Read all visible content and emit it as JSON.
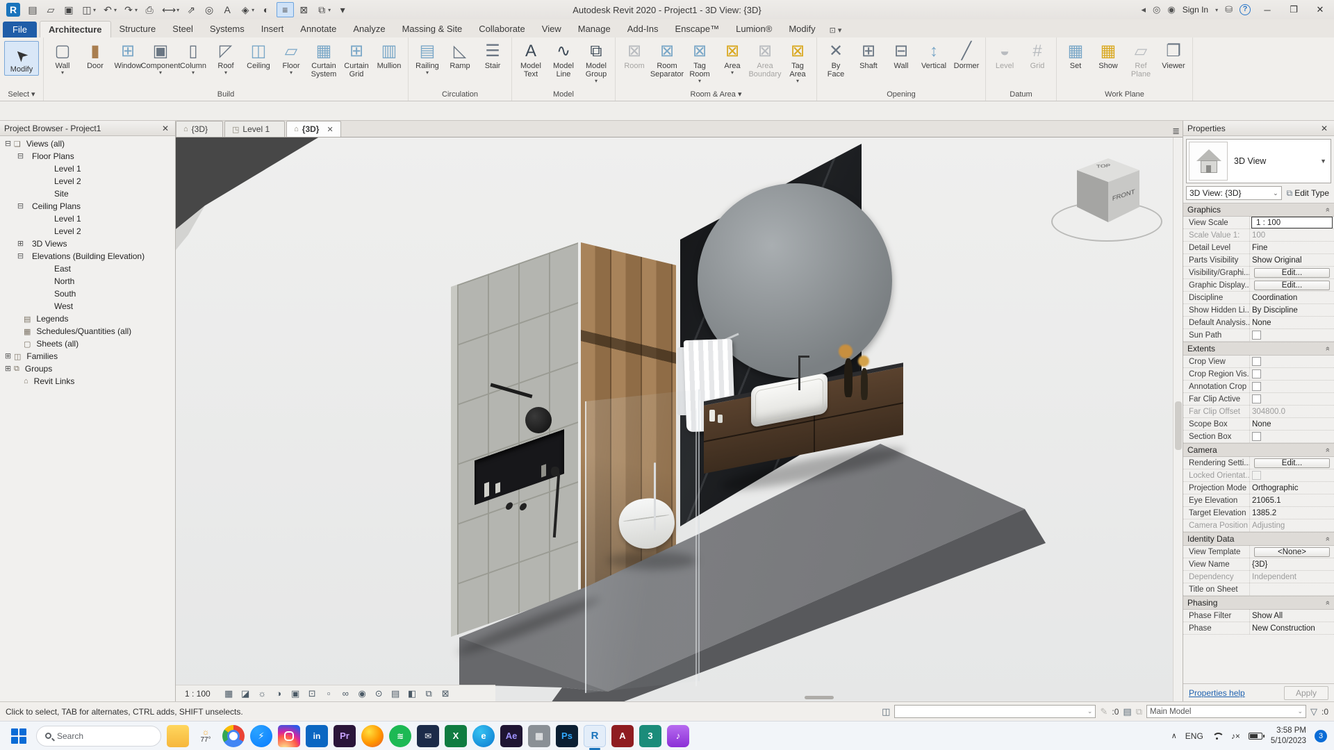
{
  "window": {
    "title": "Autodesk Revit 2020 - Project1 - 3D View: {3D}",
    "sign_in": "Sign In",
    "minimize": "─",
    "restore": "❐",
    "close": "✕"
  },
  "qat": [
    {
      "n": "revit-logo",
      "g": "R",
      "cls": "logo",
      "arrow": ""
    },
    {
      "n": "project-properties-icon",
      "g": "▤",
      "arrow": ""
    },
    {
      "n": "open-icon",
      "g": "▱",
      "arrow": ""
    },
    {
      "n": "save-icon",
      "g": "▣",
      "arrow": ""
    },
    {
      "n": "sync-with-central-icon",
      "g": "◫",
      "arrow": "▾"
    },
    {
      "n": "undo-icon",
      "g": "↶",
      "arrow": "▾"
    },
    {
      "n": "redo-icon",
      "g": "↷",
      "arrow": "▾"
    },
    {
      "n": "print-icon",
      "g": "⎙",
      "arrow": ""
    },
    {
      "n": "measure-icon",
      "g": "⟷",
      "arrow": "▾"
    },
    {
      "n": "aligned-dimension-icon",
      "g": "⇗",
      "arrow": ""
    },
    {
      "n": "tag-by-category-icon",
      "g": "◎",
      "arrow": ""
    },
    {
      "n": "text-icon",
      "g": "A",
      "arrow": ""
    },
    {
      "n": "default-3d-view-icon",
      "g": "◈",
      "arrow": "▾"
    },
    {
      "n": "section-icon",
      "g": "◐",
      "arrow": ""
    },
    {
      "n": "thin-lines-icon",
      "g": "≡",
      "cls": "active",
      "arrow": ""
    },
    {
      "n": "close-inactive-windows-icon",
      "g": "⊠",
      "arrow": ""
    },
    {
      "n": "switch-windows-icon",
      "g": "⧉",
      "arrow": "▾"
    },
    {
      "n": "customize-qat-icon",
      "g": "▾",
      "arrow": ""
    }
  ],
  "ribbon": {
    "file_tab": "File",
    "tabs": [
      {
        "label": "Architecture",
        "cls": "active"
      },
      {
        "label": "Structure"
      },
      {
        "label": "Steel"
      },
      {
        "label": "Systems"
      },
      {
        "label": "Insert"
      },
      {
        "label": "Annotate"
      },
      {
        "label": "Analyze"
      },
      {
        "label": "Massing & Site"
      },
      {
        "label": "Collaborate"
      },
      {
        "label": "View"
      },
      {
        "label": "Manage"
      },
      {
        "label": "Add-Ins"
      },
      {
        "label": "Enscape™"
      },
      {
        "label": "Lumion®"
      },
      {
        "label": "Modify"
      }
    ],
    "tab_extra": "⊡ ▾",
    "modify_label": "Modify",
    "select_label": "Select ▾",
    "panels": [
      {
        "label": "Build",
        "buttons": [
          {
            "label": "Wall",
            "glyph": "▢",
            "icls": "",
            "arrow": "▾",
            "cls": ""
          },
          {
            "label": "Door",
            "glyph": "▮",
            "icls": "i-wood",
            "arrow": "",
            "cls": ""
          },
          {
            "label": "Window",
            "glyph": "⊞",
            "icls": "i-blue",
            "arrow": "",
            "cls": ""
          },
          {
            "label": "Component",
            "glyph": "▣",
            "icls": "",
            "arrow": "▾",
            "cls": ""
          },
          {
            "label": "Column",
            "glyph": "▯",
            "icls": "",
            "arrow": "▾",
            "cls": ""
          },
          {
            "label": "Roof",
            "glyph": "◸",
            "icls": "",
            "arrow": "▾",
            "cls": ""
          },
          {
            "label": "Ceiling",
            "glyph": "◫",
            "icls": "i-blue",
            "arrow": "",
            "cls": ""
          },
          {
            "label": "Floor",
            "glyph": "▱",
            "icls": "i-blue",
            "arrow": "▾",
            "cls": ""
          },
          {
            "label": "Curtain\nSystem",
            "glyph": "▦",
            "icls": "i-blue",
            "arrow": "",
            "cls": ""
          },
          {
            "label": "Curtain\nGrid",
            "glyph": "⊞",
            "icls": "i-blue",
            "arrow": "",
            "cls": ""
          },
          {
            "label": "Mullion",
            "glyph": "▥",
            "icls": "i-blue",
            "arrow": "",
            "cls": ""
          }
        ]
      },
      {
        "label": "Circulation",
        "buttons": [
          {
            "label": "Railing",
            "glyph": "▤",
            "icls": "i-blue",
            "arrow": "▾",
            "cls": ""
          },
          {
            "label": "Ramp",
            "glyph": "◺",
            "icls": "",
            "arrow": "",
            "cls": ""
          },
          {
            "label": "Stair",
            "glyph": "☰",
            "icls": "",
            "arrow": "",
            "cls": ""
          }
        ]
      },
      {
        "label": "Model",
        "buttons": [
          {
            "label": "Model\nText",
            "glyph": "A",
            "icls": "i-dark",
            "arrow": "",
            "cls": ""
          },
          {
            "label": "Model\nLine",
            "glyph": "∿",
            "icls": "i-dark",
            "arrow": "",
            "cls": ""
          },
          {
            "label": "Model\nGroup",
            "glyph": "⧉",
            "icls": "i-dark",
            "arrow": "▾",
            "cls": ""
          }
        ]
      },
      {
        "label": "Room & Area ▾",
        "buttons": [
          {
            "label": "Room",
            "glyph": "⊠",
            "icls": "",
            "arrow": "",
            "cls": "dis"
          },
          {
            "label": "Room\nSeparator",
            "glyph": "⊠",
            "icls": "i-blue",
            "arrow": "",
            "cls": ""
          },
          {
            "label": "Tag\nRoom",
            "glyph": "⊠",
            "icls": "i-blue",
            "arrow": "▾",
            "cls": ""
          },
          {
            "label": "Area",
            "glyph": "⊠",
            "icls": "i-yellow",
            "arrow": "▾",
            "cls": ""
          },
          {
            "label": "Area\nBoundary",
            "glyph": "⊠",
            "icls": "",
            "arrow": "",
            "cls": "dis"
          },
          {
            "label": "Tag\nArea",
            "glyph": "⊠",
            "icls": "i-yellow",
            "arrow": "▾",
            "cls": ""
          }
        ]
      },
      {
        "label": "Opening",
        "buttons": [
          {
            "label": "By\nFace",
            "glyph": "✕",
            "icls": "",
            "arrow": "",
            "cls": ""
          },
          {
            "label": "Shaft",
            "glyph": "⊞",
            "icls": "",
            "arrow": "",
            "cls": ""
          },
          {
            "label": "Wall",
            "glyph": "⊟",
            "icls": "",
            "arrow": "",
            "cls": ""
          },
          {
            "label": "Vertical",
            "glyph": "↕",
            "icls": "i-blue",
            "arrow": "",
            "cls": ""
          },
          {
            "label": "Dormer",
            "glyph": "╱",
            "icls": "",
            "arrow": "",
            "cls": ""
          }
        ]
      },
      {
        "label": "Datum",
        "buttons": [
          {
            "label": "Level",
            "glyph": "◒",
            "icls": "",
            "arrow": "",
            "cls": "dis"
          },
          {
            "label": "Grid",
            "glyph": "#",
            "icls": "",
            "arrow": "",
            "cls": "dis"
          }
        ]
      },
      {
        "label": "Work Plane",
        "buttons": [
          {
            "label": "Set",
            "glyph": "▦",
            "icls": "i-blue",
            "arrow": "",
            "cls": ""
          },
          {
            "label": "Show",
            "glyph": "▦",
            "icls": "i-yellow",
            "arrow": "",
            "cls": ""
          },
          {
            "label": "Ref\nPlane",
            "glyph": "▱",
            "icls": "",
            "arrow": "",
            "cls": "dis"
          },
          {
            "label": "Viewer",
            "glyph": "❐",
            "icls": "",
            "arrow": "",
            "cls": ""
          }
        ]
      }
    ]
  },
  "browser": {
    "title": "Project Browser - Project1",
    "close": "✕",
    "tree": [
      {
        "g": "⊟",
        "ig": "❏",
        "label": "Views (all)",
        "d": "t0",
        "cls": "sel"
      },
      {
        "g": "⊟",
        "ig": "",
        "label": "Floor Plans",
        "d": "t1",
        "cls": ""
      },
      {
        "g": "",
        "ig": "",
        "label": "Level 1",
        "d": "t2",
        "cls": ""
      },
      {
        "g": "",
        "ig": "",
        "label": "Level 2",
        "d": "t2",
        "cls": ""
      },
      {
        "g": "",
        "ig": "",
        "label": "Site",
        "d": "t2",
        "cls": ""
      },
      {
        "g": "⊟",
        "ig": "",
        "label": "Ceiling Plans",
        "d": "t1",
        "cls": ""
      },
      {
        "g": "",
        "ig": "",
        "label": "Level 1",
        "d": "t2",
        "cls": ""
      },
      {
        "g": "",
        "ig": "",
        "label": "Level 2",
        "d": "t2",
        "cls": ""
      },
      {
        "g": "⊞",
        "ig": "",
        "label": "3D Views",
        "d": "t1",
        "cls": ""
      },
      {
        "g": "⊟",
        "ig": "",
        "label": "Elevations (Building Elevation)",
        "d": "t1",
        "cls": ""
      },
      {
        "g": "",
        "ig": "",
        "label": "East",
        "d": "t2",
        "cls": ""
      },
      {
        "g": "",
        "ig": "",
        "label": "North",
        "d": "t2",
        "cls": ""
      },
      {
        "g": "",
        "ig": "",
        "label": "South",
        "d": "t2",
        "cls": ""
      },
      {
        "g": "",
        "ig": "",
        "label": "West",
        "d": "t2",
        "cls": ""
      },
      {
        "g": "",
        "ig": "▤",
        "label": "Legends",
        "d": "t0b",
        "cls": ""
      },
      {
        "g": "",
        "ig": "▦",
        "label": "Schedules/Quantities (all)",
        "d": "t0b",
        "cls": ""
      },
      {
        "g": "",
        "ig": "▢",
        "label": "Sheets (all)",
        "d": "t0b",
        "cls": ""
      },
      {
        "g": "⊞",
        "ig": "◫",
        "label": "Families",
        "d": "t0",
        "cls": ""
      },
      {
        "g": "⊞",
        "ig": "⧉",
        "label": "Groups",
        "d": "t0",
        "cls": ""
      },
      {
        "g": "",
        "ig": "⌂",
        "label": "Revit Links",
        "d": "t0b",
        "cls": ""
      }
    ]
  },
  "view_tabs": {
    "tabs": [
      {
        "icon": "⌂",
        "label": "{3D}",
        "close": "",
        "cls": ""
      },
      {
        "icon": "◳",
        "label": "Level 1",
        "close": "",
        "cls": ""
      },
      {
        "icon": "⌂",
        "label": "{3D}",
        "close": "✕",
        "cls": "active"
      }
    ],
    "list_icon": "≣"
  },
  "viewcube": {
    "top": "TOP",
    "front": "FRONT"
  },
  "vcb": {
    "scale": "1 : 100",
    "icons": [
      {
        "n": "detail-level-icon",
        "g": "▦"
      },
      {
        "n": "visual-style-icon",
        "g": "◪"
      },
      {
        "n": "sun-path-icon",
        "g": "☼"
      },
      {
        "n": "shadows-icon",
        "g": "◑"
      },
      {
        "n": "show-rendering-dialog-icon",
        "g": "▣"
      },
      {
        "n": "crop-view-icon",
        "g": "⊡"
      },
      {
        "n": "show-crop-region-icon",
        "g": "▫"
      },
      {
        "n": "temporary-hide-isolate-icon",
        "g": "∞"
      },
      {
        "n": "reveal-hidden-elements-icon",
        "g": "◉"
      },
      {
        "n": "temporary-view-properties-icon",
        "g": "⊙"
      },
      {
        "n": "show-analytical-model-icon",
        "g": "▤"
      },
      {
        "n": "highlight-displacement-sets-icon",
        "g": "◧"
      },
      {
        "n": "reveal-constraints-icon",
        "g": "⧉"
      },
      {
        "n": "lock-3d-view-icon",
        "g": "⊠"
      }
    ]
  },
  "properties": {
    "title": "Properties",
    "close": "✕",
    "type_name": "3D View",
    "view_combo": "3D View: {3D}",
    "edit_type": "Edit Type",
    "sections": [
      {
        "title": "Graphics",
        "rows": [
          {
            "label": "View Scale",
            "value": "1 : 100",
            "vcls": "field",
            "lcls": ""
          },
          {
            "label": "Scale Value    1:",
            "value": "100",
            "vcls": "dis",
            "lcls": "dis"
          },
          {
            "label": "Detail Level",
            "value": "Fine",
            "vcls": "",
            "lcls": ""
          },
          {
            "label": "Parts Visibility",
            "value": "Show Original",
            "vcls": "",
            "lcls": ""
          },
          {
            "label": "Visibility/Graphi...",
            "value": "Edit...",
            "vcls": "btn",
            "lcls": ""
          },
          {
            "label": "Graphic Display...",
            "value": "Edit...",
            "vcls": "btn",
            "lcls": ""
          },
          {
            "label": "Discipline",
            "value": "Coordination",
            "vcls": "",
            "lcls": ""
          },
          {
            "label": "Show Hidden Li...",
            "value": "By Discipline",
            "vcls": "",
            "lcls": ""
          },
          {
            "label": "Default Analysis...",
            "value": "None",
            "vcls": "",
            "lcls": ""
          },
          {
            "label": "Sun Path",
            "value": "",
            "vcls": "check",
            "lcls": ""
          }
        ]
      },
      {
        "title": "Extents",
        "rows": [
          {
            "label": "Crop View",
            "value": "",
            "vcls": "check",
            "lcls": ""
          },
          {
            "label": "Crop Region Vis...",
            "value": "",
            "vcls": "check",
            "lcls": ""
          },
          {
            "label": "Annotation Crop",
            "value": "",
            "vcls": "check",
            "lcls": ""
          },
          {
            "label": "Far Clip Active",
            "value": "",
            "vcls": "check",
            "lcls": ""
          },
          {
            "label": "Far Clip Offset",
            "value": "304800.0",
            "vcls": "dis",
            "lcls": "dis"
          },
          {
            "label": "Scope Box",
            "value": "None",
            "vcls": "",
            "lcls": ""
          },
          {
            "label": "Section Box",
            "value": "",
            "vcls": "check",
            "lcls": ""
          }
        ]
      },
      {
        "title": "Camera",
        "rows": [
          {
            "label": "Rendering Setti...",
            "value": "Edit...",
            "vcls": "btn",
            "lcls": ""
          },
          {
            "label": "Locked Orientat...",
            "value": "",
            "vcls": "check dis",
            "lcls": "dis"
          },
          {
            "label": "Projection Mode",
            "value": "Orthographic",
            "vcls": "",
            "lcls": ""
          },
          {
            "label": "Eye Elevation",
            "value": "21065.1",
            "vcls": "",
            "lcls": ""
          },
          {
            "label": "Target Elevation",
            "value": "1385.2",
            "vcls": "",
            "lcls": ""
          },
          {
            "label": "Camera Position",
            "value": "Adjusting",
            "vcls": "dis",
            "lcls": "dis"
          }
        ]
      },
      {
        "title": "Identity Data",
        "rows": [
          {
            "label": "View Template",
            "value": "<None>",
            "vcls": "btn",
            "lcls": ""
          },
          {
            "label": "View Name",
            "value": "{3D}",
            "vcls": "",
            "lcls": ""
          },
          {
            "label": "Dependency",
            "value": "Independent",
            "vcls": "dis",
            "lcls": "dis"
          },
          {
            "label": "Title on Sheet",
            "value": "",
            "vcls": "",
            "lcls": ""
          }
        ]
      },
      {
        "title": "Phasing",
        "rows": [
          {
            "label": "Phase Filter",
            "value": "Show All",
            "vcls": "",
            "lcls": ""
          },
          {
            "label": "Phase",
            "value": "New Construction",
            "vcls": "",
            "lcls": ""
          }
        ]
      }
    ],
    "help": "Properties help",
    "apply": "Apply"
  },
  "status_bar": {
    "hint": "Click to select, TAB for alternates, CTRL adds, SHIFT unselects.",
    "workset_value": "",
    "editable_count": ":0",
    "main_model": "Main Model",
    "filter_count": ":0"
  },
  "taskbar": {
    "search_placeholder": "Search",
    "icons": [
      {
        "n": "file-explorer-icon",
        "cls": "tb-folder",
        "g": "",
        "label": ""
      },
      {
        "n": "weather-icon",
        "cls": "tb-weather",
        "g": "☼",
        "label": "77°"
      },
      {
        "n": "chrome-icon",
        "cls": "tb-chrome",
        "g": "",
        "label": ""
      },
      {
        "n": "messenger-icon",
        "cls": "tb-msg",
        "g": "⚡",
        "label": ""
      },
      {
        "n": "instagram-icon",
        "cls": "tb-insta",
        "g": "",
        "label": ""
      },
      {
        "n": "linkedin-icon",
        "cls": "tb-li",
        "g": "in",
        "label": ""
      },
      {
        "n": "premiere-icon",
        "cls": "tb-pr",
        "g": "Pr",
        "label": ""
      },
      {
        "n": "firefox-icon",
        "cls": "tb-ff",
        "g": "",
        "label": ""
      },
      {
        "n": "spotify-icon",
        "cls": "tb-sp",
        "g": "≋",
        "label": ""
      },
      {
        "n": "mail-icon",
        "cls": "tb-mail",
        "g": "✉",
        "label": ""
      },
      {
        "n": "excel-icon",
        "cls": "tb-xl",
        "g": "X",
        "label": ""
      },
      {
        "n": "edge-icon",
        "cls": "tb-edge",
        "g": "e",
        "label": ""
      },
      {
        "n": "after-effects-icon",
        "cls": "tb-ae",
        "g": "Ae",
        "label": ""
      },
      {
        "n": "system-app-icon",
        "cls": "tb-gray",
        "g": "▦",
        "label": ""
      },
      {
        "n": "photoshop-icon",
        "cls": "tb-ps",
        "g": "Ps",
        "label": ""
      },
      {
        "n": "revit-icon",
        "cls": "tb-revit active-app",
        "g": "R",
        "label": ""
      },
      {
        "n": "acrobat-icon",
        "cls": "tb-acr",
        "g": "A",
        "label": ""
      },
      {
        "n": "3ds-max-icon",
        "cls": "tb-max",
        "g": "3",
        "label": ""
      },
      {
        "n": "music-icon",
        "cls": "tb-music",
        "g": "♪",
        "label": ""
      }
    ],
    "tray": {
      "hidden": "∧",
      "lang": "ENG",
      "time": "3:58 PM",
      "date": "5/10/2023",
      "badge": "3"
    }
  }
}
